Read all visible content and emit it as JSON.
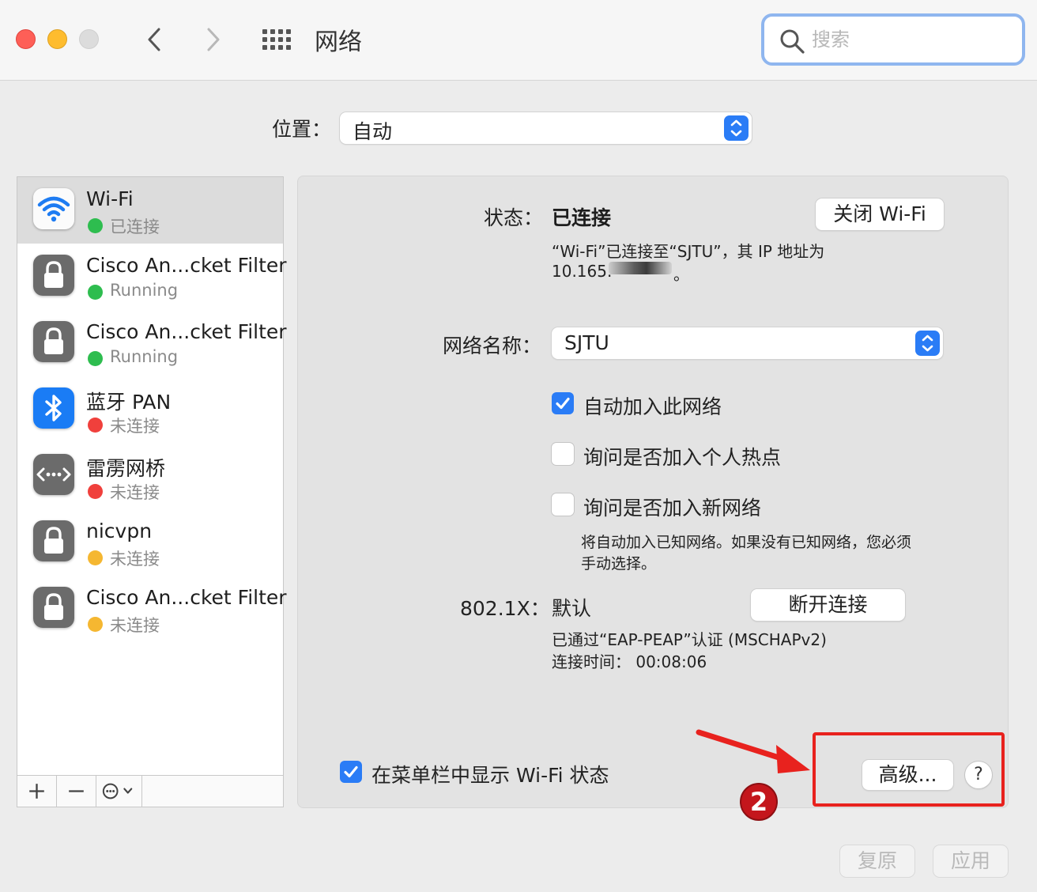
{
  "window": {
    "title": "网络"
  },
  "search": {
    "placeholder": "搜索",
    "value": ""
  },
  "location": {
    "label": "位置：",
    "value": "自动"
  },
  "services": [
    {
      "name": "Wi-Fi",
      "status": "已连接",
      "status_color": "#2ebd4f",
      "icon": "wifi-icon",
      "selected": true
    },
    {
      "name": "Cisco An...cket Filter",
      "status": "Running",
      "status_color": "#2ebd4f",
      "icon": "lock-icon"
    },
    {
      "name": "Cisco An...cket Filter",
      "status": "Running",
      "status_color": "#2ebd4f",
      "icon": "lock-icon"
    },
    {
      "name": "蓝牙 PAN",
      "status": "未连接",
      "status_color": "#f0403c",
      "icon": "bluetooth-icon"
    },
    {
      "name": "雷雳网桥",
      "status": "未连接",
      "status_color": "#f0403c",
      "icon": "thunderbolt-bridge-icon"
    },
    {
      "name": "nicvpn",
      "status": "未连接",
      "status_color": "#f5b731",
      "icon": "lock-icon"
    },
    {
      "name": "Cisco An...cket Filter",
      "status": "未连接",
      "status_color": "#f5b731",
      "icon": "lock-icon"
    }
  ],
  "status": {
    "label": "状态：",
    "value": "已连接",
    "turn_off_button": "关闭 Wi-Fi",
    "desc_line1": "“Wi-Fi”已连接至“SJTU”，其 IP 地址为",
    "desc_line2_prefix": "10.165.",
    "desc_line2_suffix": "。"
  },
  "network_name": {
    "label": "网络名称：",
    "value": "SJTU"
  },
  "options": {
    "auto_join": {
      "label": "自动加入此网络",
      "checked": true
    },
    "ask_hotspot": {
      "label": "询问是否加入个人热点",
      "checked": false
    },
    "ask_new": {
      "label": "询问是否加入新网络",
      "checked": false
    },
    "note_line1": "将自动加入已知网络。如果没有已知网络，您必须",
    "note_line2": "手动选择。"
  },
  "dot1x": {
    "label": "802.1X：",
    "value": "默认",
    "disconnect_button": "断开连接",
    "auth_line": "已通过“EAP-PEAP”认证 (MSCHAPv2)",
    "time_line": "连接时间：  00:08:06"
  },
  "show_in_menubar": {
    "label": "在菜单栏中显示 Wi-Fi 状态",
    "checked": true
  },
  "advanced_button": "高级...",
  "help_button": "?",
  "revert_button": "复原",
  "apply_button": "应用",
  "annotation_number": "2",
  "accent_color": "#2a7cf6",
  "annotation_color": "#e8221e"
}
